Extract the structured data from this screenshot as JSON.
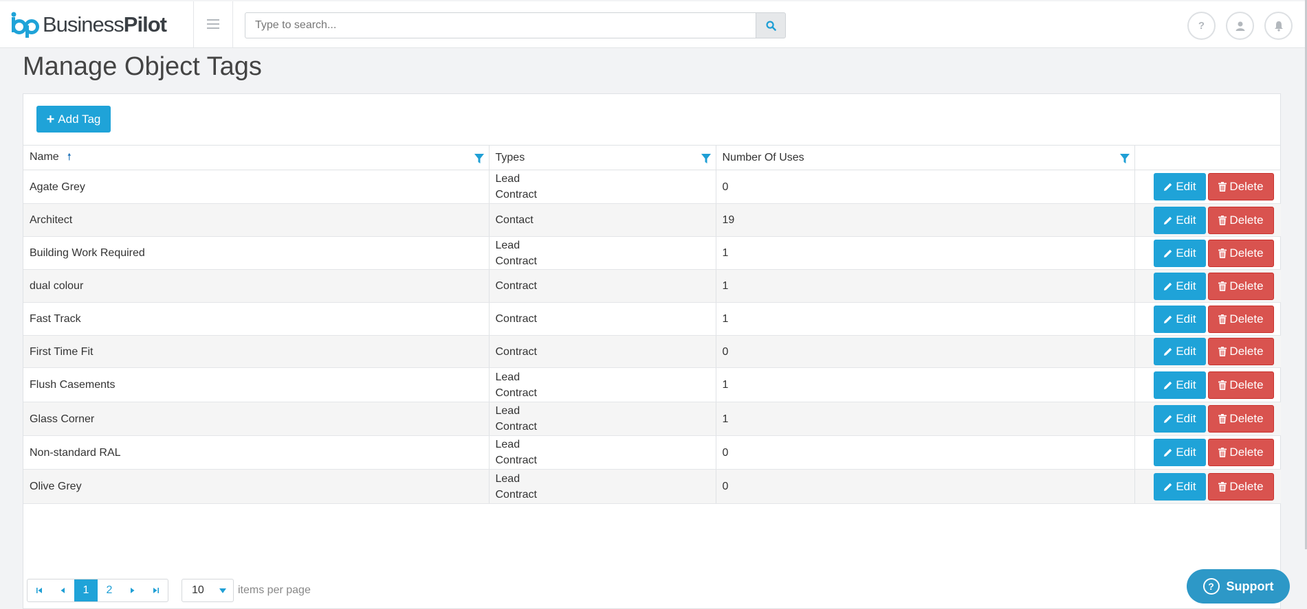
{
  "header": {
    "logo_text_regular": "Business",
    "logo_text_bold": "Pilot",
    "search_placeholder": "Type to search...",
    "help_label": "?"
  },
  "page": {
    "title": "Manage Object Tags",
    "add_button_label": "Add Tag"
  },
  "table": {
    "columns": [
      "Name",
      "Types",
      "Number Of Uses"
    ],
    "edit_label": "Edit",
    "delete_label": "Delete",
    "rows": [
      {
        "name": "Agate Grey",
        "types": [
          "Lead",
          "Contract"
        ],
        "uses": "0"
      },
      {
        "name": "Architect",
        "types": [
          "Contact"
        ],
        "uses": "19"
      },
      {
        "name": "Building Work Required",
        "types": [
          "Lead",
          "Contract"
        ],
        "uses": "1"
      },
      {
        "name": "dual colour",
        "types": [
          "Contract"
        ],
        "uses": "1"
      },
      {
        "name": "Fast Track",
        "types": [
          "Contract"
        ],
        "uses": "1"
      },
      {
        "name": "First Time Fit",
        "types": [
          "Contract"
        ],
        "uses": "0"
      },
      {
        "name": "Flush Casements",
        "types": [
          "Lead",
          "Contract"
        ],
        "uses": "1"
      },
      {
        "name": "Glass Corner",
        "types": [
          "Lead",
          "Contract"
        ],
        "uses": "1"
      },
      {
        "name": "Non-standard RAL",
        "types": [
          "Lead",
          "Contract"
        ],
        "uses": "0"
      },
      {
        "name": "Olive Grey",
        "types": [
          "Lead",
          "Contract"
        ],
        "uses": "0"
      }
    ]
  },
  "pager": {
    "pages": [
      "1",
      "2"
    ],
    "current_page": "1",
    "page_size": "10",
    "items_label": "items per page"
  },
  "support_label": "Support",
  "colors": {
    "primary": "#1fa3d8",
    "danger": "#d9534f",
    "support": "#2d98c7"
  }
}
